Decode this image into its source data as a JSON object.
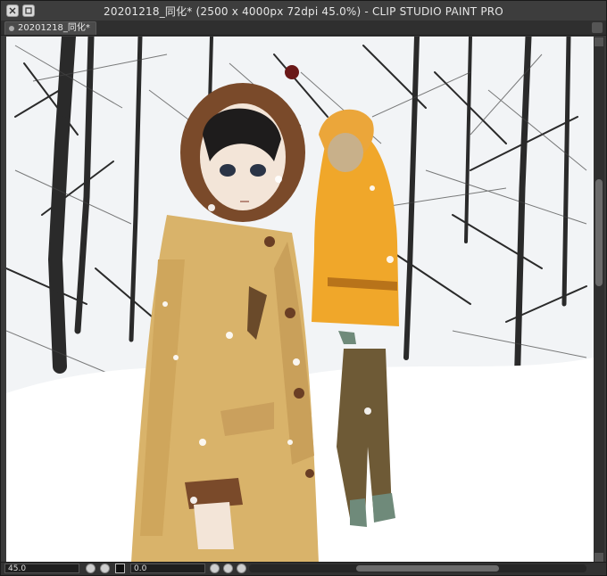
{
  "window": {
    "title": "20201218_同化* (2500 x 4000px 72dpi 45.0%)  - CLIP STUDIO PAINT PRO"
  },
  "tab": {
    "label": "20201218_同化*"
  },
  "statusbar": {
    "zoom_value": "45.0",
    "angle_value": "0.0"
  },
  "canvas": {
    "description_icons": [
      "zoom-out-icon",
      "zoom-in-icon",
      "fit-icon",
      "rotate-left-icon",
      "rotate-right-icon",
      "reset-icon"
    ],
    "colors": {
      "snow": "#f4f6f8",
      "coat_left": "#d9b36a",
      "coat_right": "#f0a72a",
      "fur": "#7a4a2a",
      "trees": "#2a2a2a"
    }
  }
}
